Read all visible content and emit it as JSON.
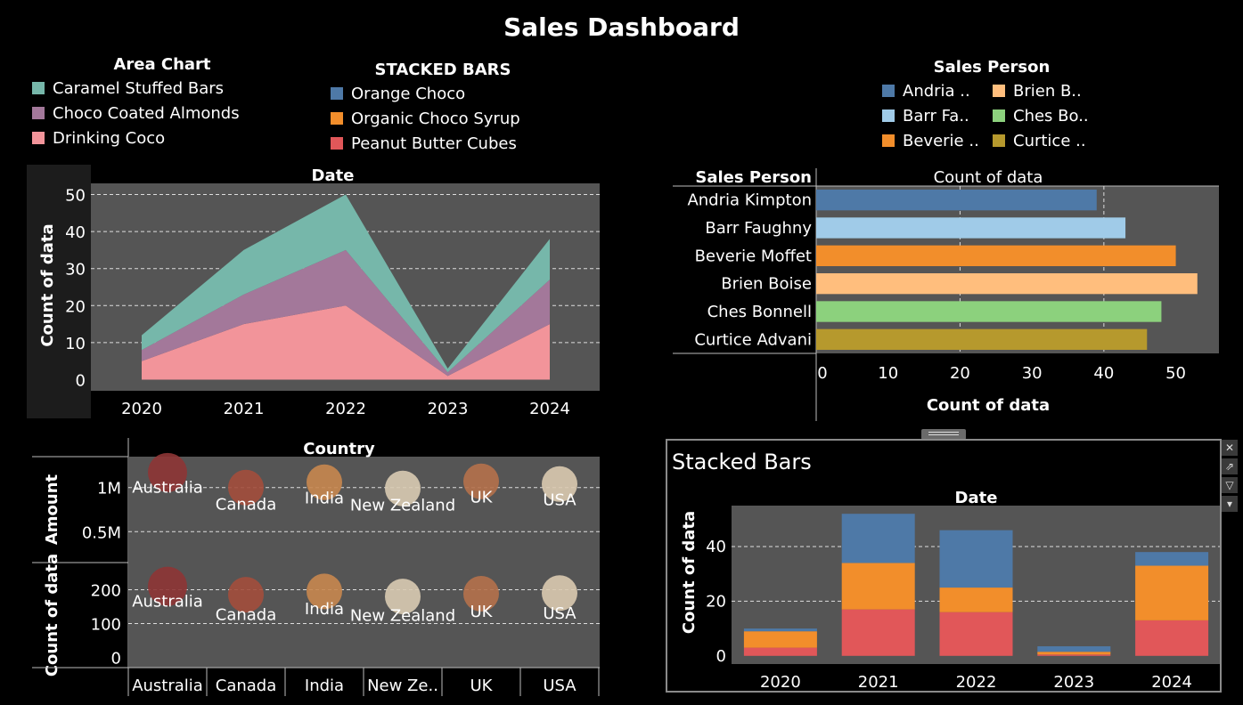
{
  "dashboard": {
    "title": "Sales Dashboard"
  },
  "area_legend": {
    "title": "Area Chart",
    "items": [
      {
        "label": "Caramel Stuffed Bars",
        "color": "#76b7aa"
      },
      {
        "label": "Choco Coated Almonds",
        "color": "#a3789a"
      },
      {
        "label": "Drinking Coco",
        "color": "#f2949a"
      }
    ]
  },
  "stacked_legend": {
    "title": "STACKED BARS",
    "items": [
      {
        "label": "Orange Choco",
        "color": "#4e79a7"
      },
      {
        "label": "Organic Choco Syrup",
        "color": "#f28e2b"
      },
      {
        "label": "Peanut Butter Cubes",
        "color": "#e15759"
      }
    ]
  },
  "person_legend": {
    "title": "Sales Person",
    "items": [
      {
        "label": "Andria ..",
        "color": "#4e79a7"
      },
      {
        "label": "Brien B..",
        "color": "#ffbe7d"
      },
      {
        "label": "Barr Fa..",
        "color": "#a0cbe8"
      },
      {
        "label": "Ches Bo..",
        "color": "#8cd17d"
      },
      {
        "label": "Beverie ..",
        "color": "#f28e2b"
      },
      {
        "label": "Curtice ..",
        "color": "#b6992d"
      }
    ]
  },
  "stacked_panel": {
    "title": "Stacked Bars"
  },
  "chart_data": [
    {
      "type": "area",
      "title": "Date",
      "ylabel": "Count of data",
      "x": [
        "2020",
        "2021",
        "2022",
        "2023",
        "2024"
      ],
      "ylim": [
        -3,
        53
      ],
      "yticks": [
        0,
        10,
        20,
        30,
        40,
        50
      ],
      "grid": true,
      "series": [
        {
          "name": "Drinking Coco",
          "color": "#f2949a",
          "values": [
            5,
            15,
            20,
            1,
            15
          ]
        },
        {
          "name": "Choco Coated Almonds",
          "color": "#a3789a",
          "values": [
            3,
            8,
            15,
            1,
            12
          ]
        },
        {
          "name": "Caramel Stuffed Bars",
          "color": "#76b7aa",
          "values": [
            4,
            12,
            15,
            1,
            11
          ]
        }
      ]
    },
    {
      "type": "bar",
      "orientation": "horizontal",
      "title": "Count of data",
      "row_header": "Sales Person",
      "xlabel": "Count of data",
      "categories": [
        "Andria Kimpton",
        "Barr Faughny",
        "Beverie Moffet",
        "Brien Boise",
        "Ches Bonnell",
        "Curtice Advani"
      ],
      "values": [
        39,
        43,
        50,
        53,
        48,
        46
      ],
      "colors": [
        "#4e79a7",
        "#a0cbe8",
        "#f28e2b",
        "#ffbe7d",
        "#8cd17d",
        "#b6992d"
      ],
      "xlim": [
        0,
        56
      ],
      "xticks": [
        0,
        10,
        20,
        30,
        40,
        50
      ],
      "grid": true
    },
    {
      "type": "scatter",
      "title": "Country",
      "categories": [
        "Australia",
        "Canada",
        "India",
        "New Zealand",
        "UK",
        "USA"
      ],
      "axis_labels": [
        "Australia",
        "Canada",
        "India",
        "New Ze..",
        "UK",
        "USA"
      ],
      "colors": [
        "#8e3535",
        "#a34e3c",
        "#c8874f",
        "#d9cbb3",
        "#b5714b",
        "#dacab0"
      ],
      "panes": [
        {
          "ylabel": "Amount",
          "yticks": [
            {
              "value": 1000000,
              "label": "1M"
            },
            {
              "value": 500000,
              "label": "0.5M"
            }
          ],
          "ylim": [
            150000,
            1350000
          ],
          "values": [
            1170000,
            1000000,
            1060000,
            990000,
            1070000,
            1040000
          ],
          "label_values": [
            940000,
            750000,
            820000,
            740000,
            830000,
            800000
          ]
        },
        {
          "ylabel": "Count of data",
          "yticks": [
            {
              "value": 200,
              "label": "200"
            },
            {
              "value": 100,
              "label": "100"
            },
            {
              "value": 0,
              "label": "0"
            }
          ],
          "ylim": [
            -30,
            280
          ],
          "values": [
            210,
            185,
            195,
            180,
            188,
            190
          ],
          "label_values": [
            150,
            110,
            127,
            108,
            120,
            115
          ]
        }
      ]
    },
    {
      "type": "bar",
      "stacked": true,
      "title": "Date",
      "ylabel": "Count of data",
      "categories": [
        "2020",
        "2021",
        "2022",
        "2023",
        "2024"
      ],
      "ylim": [
        -3,
        55
      ],
      "yticks": [
        0,
        20,
        40
      ],
      "grid": true,
      "series": [
        {
          "name": "Peanut Butter Cubes",
          "color": "#e15759",
          "values": [
            3,
            17,
            16,
            0.5,
            13
          ]
        },
        {
          "name": "Organic Choco Syrup",
          "color": "#f28e2b",
          "values": [
            6,
            17,
            9,
            1,
            20
          ]
        },
        {
          "name": "Orange Choco",
          "color": "#4e79a7",
          "values": [
            1,
            18,
            21,
            2,
            5
          ]
        }
      ]
    }
  ]
}
